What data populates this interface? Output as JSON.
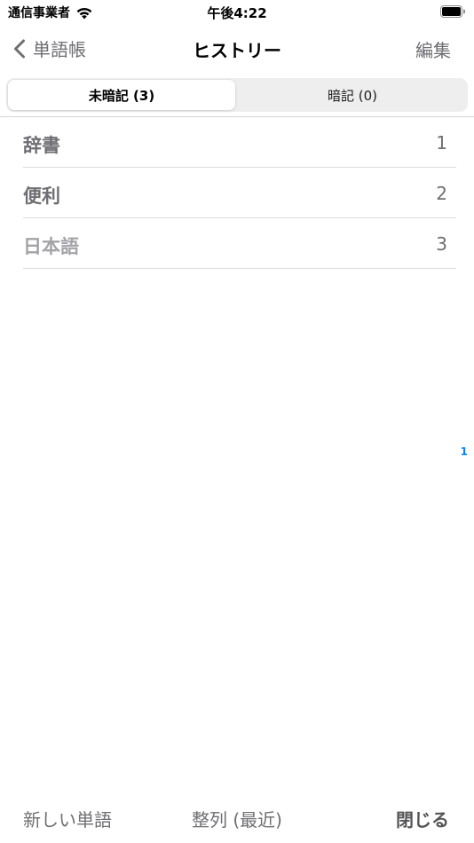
{
  "status_bar": {
    "carrier": "通信事業者",
    "time": "午後4:22",
    "wifi_icon": "wifi-icon",
    "battery_icon": "battery-icon"
  },
  "nav": {
    "back_label": "単語帳",
    "title": "ヒストリー",
    "edit_label": "編集"
  },
  "segments": [
    {
      "label": "未暗記 (3)",
      "selected": true
    },
    {
      "label": "暗記 (0)",
      "selected": false
    }
  ],
  "words": [
    {
      "text": "辞書",
      "count": "1"
    },
    {
      "text": "便利",
      "count": "2"
    },
    {
      "text": "日本語",
      "count": "3"
    }
  ],
  "index_bar": {
    "label": "1",
    "color": "#0a84ff"
  },
  "toolbar": {
    "new_word_label": "新しい単語",
    "sort_label": "整列 (最近)",
    "close_label": "閉じる"
  }
}
